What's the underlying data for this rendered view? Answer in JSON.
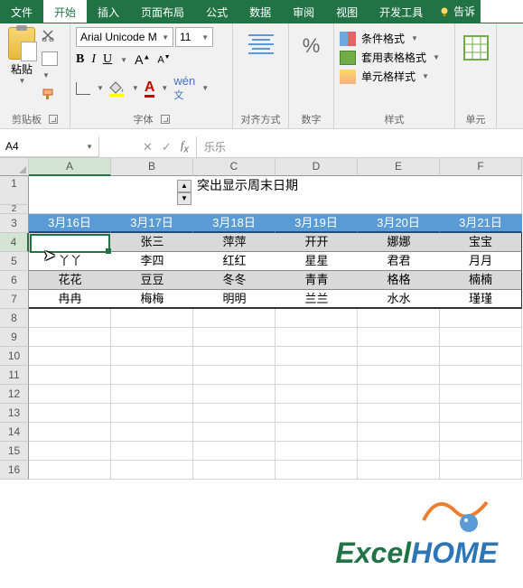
{
  "tabs": {
    "file": "文件",
    "home": "开始",
    "insert": "插入",
    "layout": "页面布局",
    "formula": "公式",
    "data": "数据",
    "review": "审阅",
    "view": "视图",
    "dev": "开发工具",
    "tellme": "告诉"
  },
  "ribbon": {
    "paste": "粘贴",
    "clipboard": "剪贴板",
    "font_name": "Arial Unicode M",
    "font_size": "11",
    "font_group": "字体",
    "align": "对齐方式",
    "number": "数字",
    "cond_fmt": "条件格式",
    "table_fmt": "套用表格格式",
    "cell_style": "单元格样式",
    "styles": "样式",
    "cells": "单元"
  },
  "namebox": "A4",
  "formula_value": "乐乐",
  "columns": [
    "A",
    "B",
    "C",
    "D",
    "E",
    "F"
  ],
  "title": "突出显示周末日期",
  "headers": [
    "3月16日",
    "3月17日",
    "3月18日",
    "3月19日",
    "3月20日",
    "3月21日"
  ],
  "rows": [
    [
      "乐乐",
      "张三",
      "萍萍",
      "开开",
      "娜娜",
      "宝宝"
    ],
    [
      "丫丫",
      "李四",
      "红红",
      "星星",
      "君君",
      "月月"
    ],
    [
      "花花",
      "豆豆",
      "冬冬",
      "青青",
      "格格",
      "楠楠"
    ],
    [
      "冉冉",
      "梅梅",
      "明明",
      "兰兰",
      "水水",
      "瑾瑾"
    ]
  ],
  "logo": {
    "excel": "Excel",
    "home": "HOME"
  }
}
